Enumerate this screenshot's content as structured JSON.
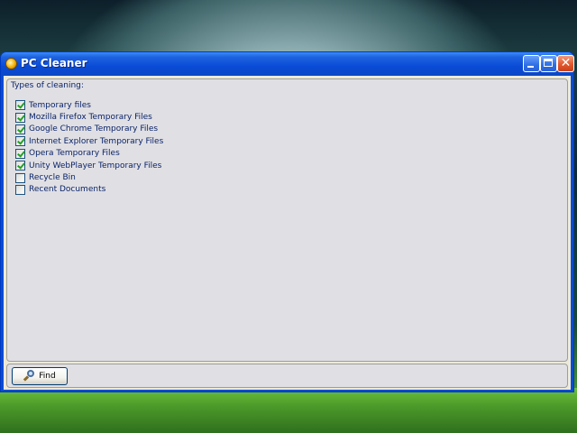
{
  "window": {
    "title": "PC Cleaner",
    "icon": "pc-cleaner-app-icon",
    "controls": {
      "minimize": "minimize-icon",
      "maximize": "maximize-icon",
      "close_symbol": "✕"
    }
  },
  "group": {
    "title": "Types of cleaning:",
    "items": [
      {
        "label": "Temporary files",
        "checked": true
      },
      {
        "label": "Mozilla Firefox Temporary Files",
        "checked": true
      },
      {
        "label": "Google Chrome Temporary Files",
        "checked": true
      },
      {
        "label": "Internet Explorer Temporary Files",
        "checked": true
      },
      {
        "label": "Opera Temporary Files",
        "checked": true
      },
      {
        "label": "Unity WebPlayer Temporary Files",
        "checked": true
      },
      {
        "label": "Recycle Bin",
        "checked": false
      },
      {
        "label": "Recent Documents",
        "checked": false
      }
    ]
  },
  "actions": {
    "find_label": "Find",
    "find_icon": "magnifier-icon"
  },
  "colors": {
    "titlebar": "#0a4bd6",
    "client": "#e0dfe3",
    "label_text": "#0a246a",
    "check": "#21a121"
  }
}
